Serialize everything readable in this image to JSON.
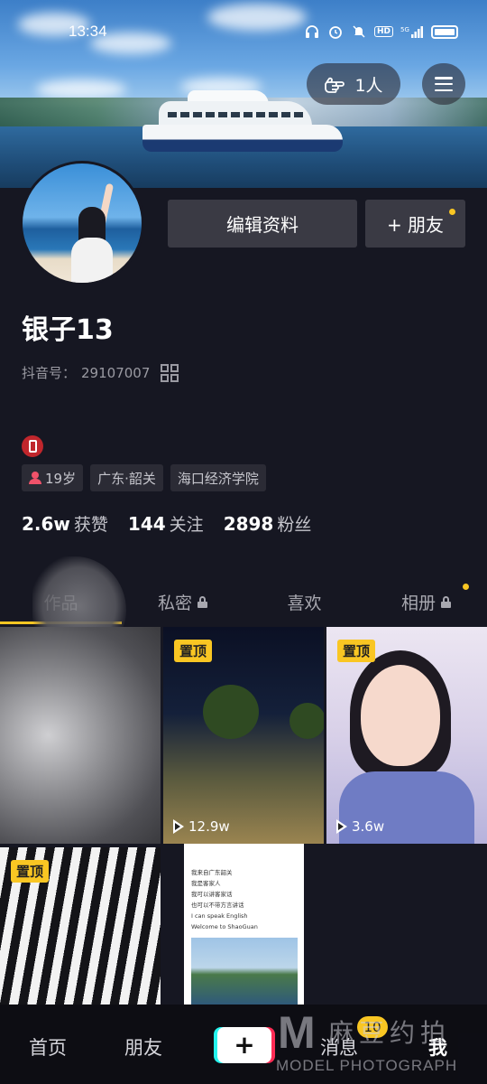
{
  "status_bar": {
    "time": "13:34",
    "hd": "HD",
    "network": "5G"
  },
  "header": {
    "visitors_label": "1人"
  },
  "profile": {
    "edit_label": "编辑资料",
    "add_friend_label": "+ 朋友",
    "name": "银子13",
    "douyin_id_label": "抖音号：",
    "douyin_id": "29107007",
    "tags": [
      "19岁",
      "广东·韶关",
      "海口经济学院"
    ],
    "stats": [
      {
        "num": "2.6w",
        "label": "获赞"
      },
      {
        "num": "144",
        "label": "关注"
      },
      {
        "num": "2898",
        "label": "粉丝"
      }
    ]
  },
  "tabs": [
    {
      "label": "作品",
      "active": true
    },
    {
      "label": "私密",
      "locked": true
    },
    {
      "label": "喜欢"
    },
    {
      "label": "相册",
      "locked": true
    }
  ],
  "grid": {
    "pin_label": "置顶",
    "items": [
      {
        "plays": ""
      },
      {
        "plays": "12.9w"
      },
      {
        "plays": "3.6w"
      },
      {
        "plays": ""
      },
      {
        "plays": ""
      }
    ],
    "message_lines": [
      "我来自广东韶关",
      "我是客家人",
      "我可以讲客家话",
      "也可以不带方言讲话",
      "I can speak English",
      "Welcome to ShaoGuan"
    ]
  },
  "bottom_nav": {
    "items": [
      "首页",
      "朋友",
      "消息",
      "我"
    ],
    "message_badge": "10"
  },
  "watermark": {
    "cn": "麻豆约拍",
    "en": "MODEL PHOTOGRAPH",
    "letter": "M"
  },
  "colors": {
    "accent": "#f9c623",
    "background": "#161722",
    "button": "#3a3a44"
  }
}
